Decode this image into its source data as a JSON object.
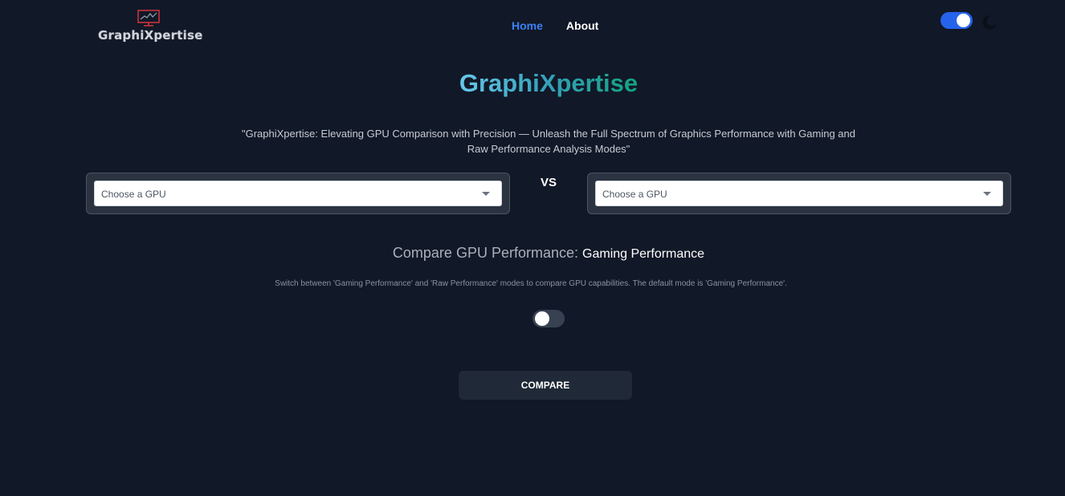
{
  "header": {
    "logo_text": "GraphiXpertise",
    "nav": [
      {
        "label": "Home",
        "active": true
      },
      {
        "label": "About",
        "active": false
      }
    ],
    "theme_toggle": {
      "on": true,
      "icon": "moon-icon"
    }
  },
  "hero": {
    "title": "GraphiXpertise",
    "tagline": "\"GraphiXpertise: Elevating GPU Comparison with Precision — Unleash the Full Spectrum of Graphics Performance with Gaming and Raw Performance Analysis Modes\""
  },
  "selectors": {
    "left_placeholder": "Choose a GPU",
    "right_placeholder": "Choose a GPU",
    "vs_label": "VS"
  },
  "mode": {
    "heading_label": "Compare GPU Performance:",
    "current_mode": "Gaming Performance",
    "description": "Switch between 'Gaming Performance' and 'Raw Performance' modes to compare GPU capabilities. The default mode is 'Gaming Performance'.",
    "toggle_on": false
  },
  "actions": {
    "compare_label": "COMPARE"
  },
  "colors": {
    "background": "#111827",
    "accent": "#3b82f6",
    "toggle_on": "#2563eb"
  }
}
